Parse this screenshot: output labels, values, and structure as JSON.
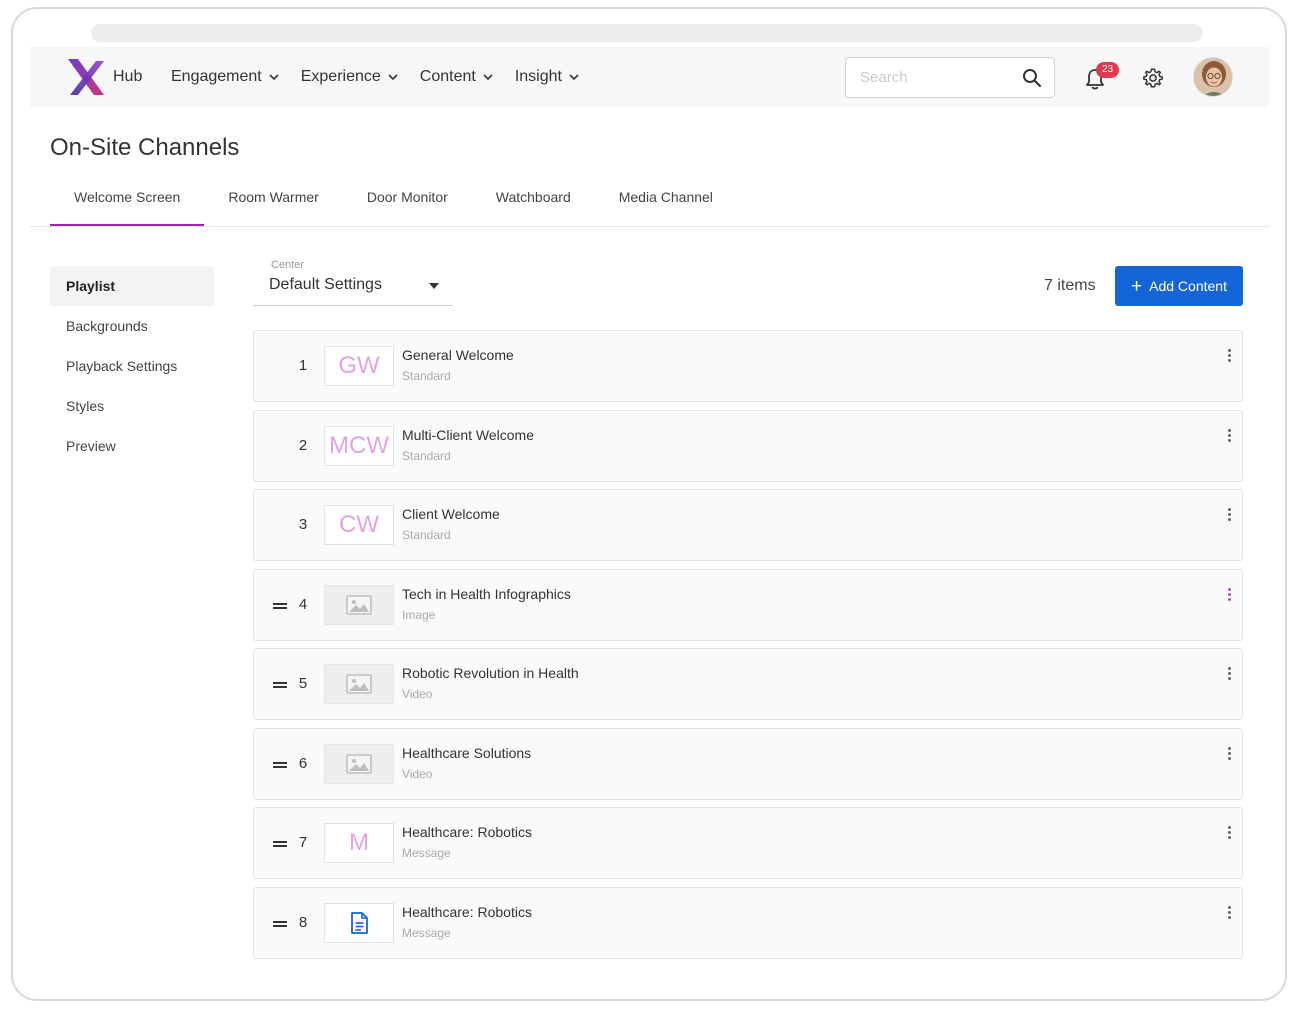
{
  "nav": {
    "hub_label": "Hub",
    "menu": [
      {
        "label": "Engagement"
      },
      {
        "label": "Experience"
      },
      {
        "label": "Content"
      },
      {
        "label": "Insight"
      }
    ],
    "search_placeholder": "Search",
    "notifications_count": "23"
  },
  "page": {
    "title": "On-Site Channels"
  },
  "tabs": [
    {
      "label": "Welcome Screen",
      "active": true
    },
    {
      "label": "Room Warmer"
    },
    {
      "label": "Door Monitor"
    },
    {
      "label": "Watchboard"
    },
    {
      "label": "Media Channel"
    }
  ],
  "sidebar": {
    "items": [
      {
        "label": "Playlist",
        "active": true
      },
      {
        "label": "Backgrounds"
      },
      {
        "label": "Playback Settings"
      },
      {
        "label": "Styles"
      },
      {
        "label": "Preview"
      }
    ]
  },
  "center_select": {
    "label": "Center",
    "value": "Default Settings"
  },
  "toolbar": {
    "items_count": "7 items",
    "add_label": "Add Content"
  },
  "colors": {
    "accent": "#9b2aa8",
    "primary_button": "#1565d8",
    "badge": "#e0384f",
    "initials": "#e2a3e4"
  },
  "playlist": [
    {
      "num": "1",
      "thumb_text": "GW",
      "title": "General Welcome",
      "type": "Standard",
      "thumb_kind": "text",
      "draggable": false
    },
    {
      "num": "2",
      "thumb_text": "MCW",
      "title": "Multi-Client Welcome",
      "type": "Standard",
      "thumb_kind": "text",
      "draggable": false
    },
    {
      "num": "3",
      "thumb_text": "CW",
      "title": "Client Welcome",
      "type": "Standard",
      "thumb_kind": "text",
      "draggable": false
    },
    {
      "num": "4",
      "thumb_text": "",
      "title": "Tech in Health Infographics",
      "type": "Image",
      "thumb_kind": "image-icon",
      "draggable": true
    },
    {
      "num": "5",
      "thumb_text": "",
      "title": "Robotic Revolution in Health",
      "type": "Video",
      "thumb_kind": "image-icon",
      "draggable": true
    },
    {
      "num": "6",
      "thumb_text": "",
      "title": "Healthcare Solutions",
      "type": "Video",
      "thumb_kind": "image-icon",
      "draggable": true
    },
    {
      "num": "7",
      "thumb_text": "M",
      "title": "Healthcare: Robotics",
      "type": "Message",
      "thumb_kind": "text",
      "draggable": true
    },
    {
      "num": "8",
      "thumb_text": "",
      "title": "Healthcare: Robotics",
      "type": "Message",
      "thumb_kind": "document-icon",
      "draggable": true
    }
  ]
}
